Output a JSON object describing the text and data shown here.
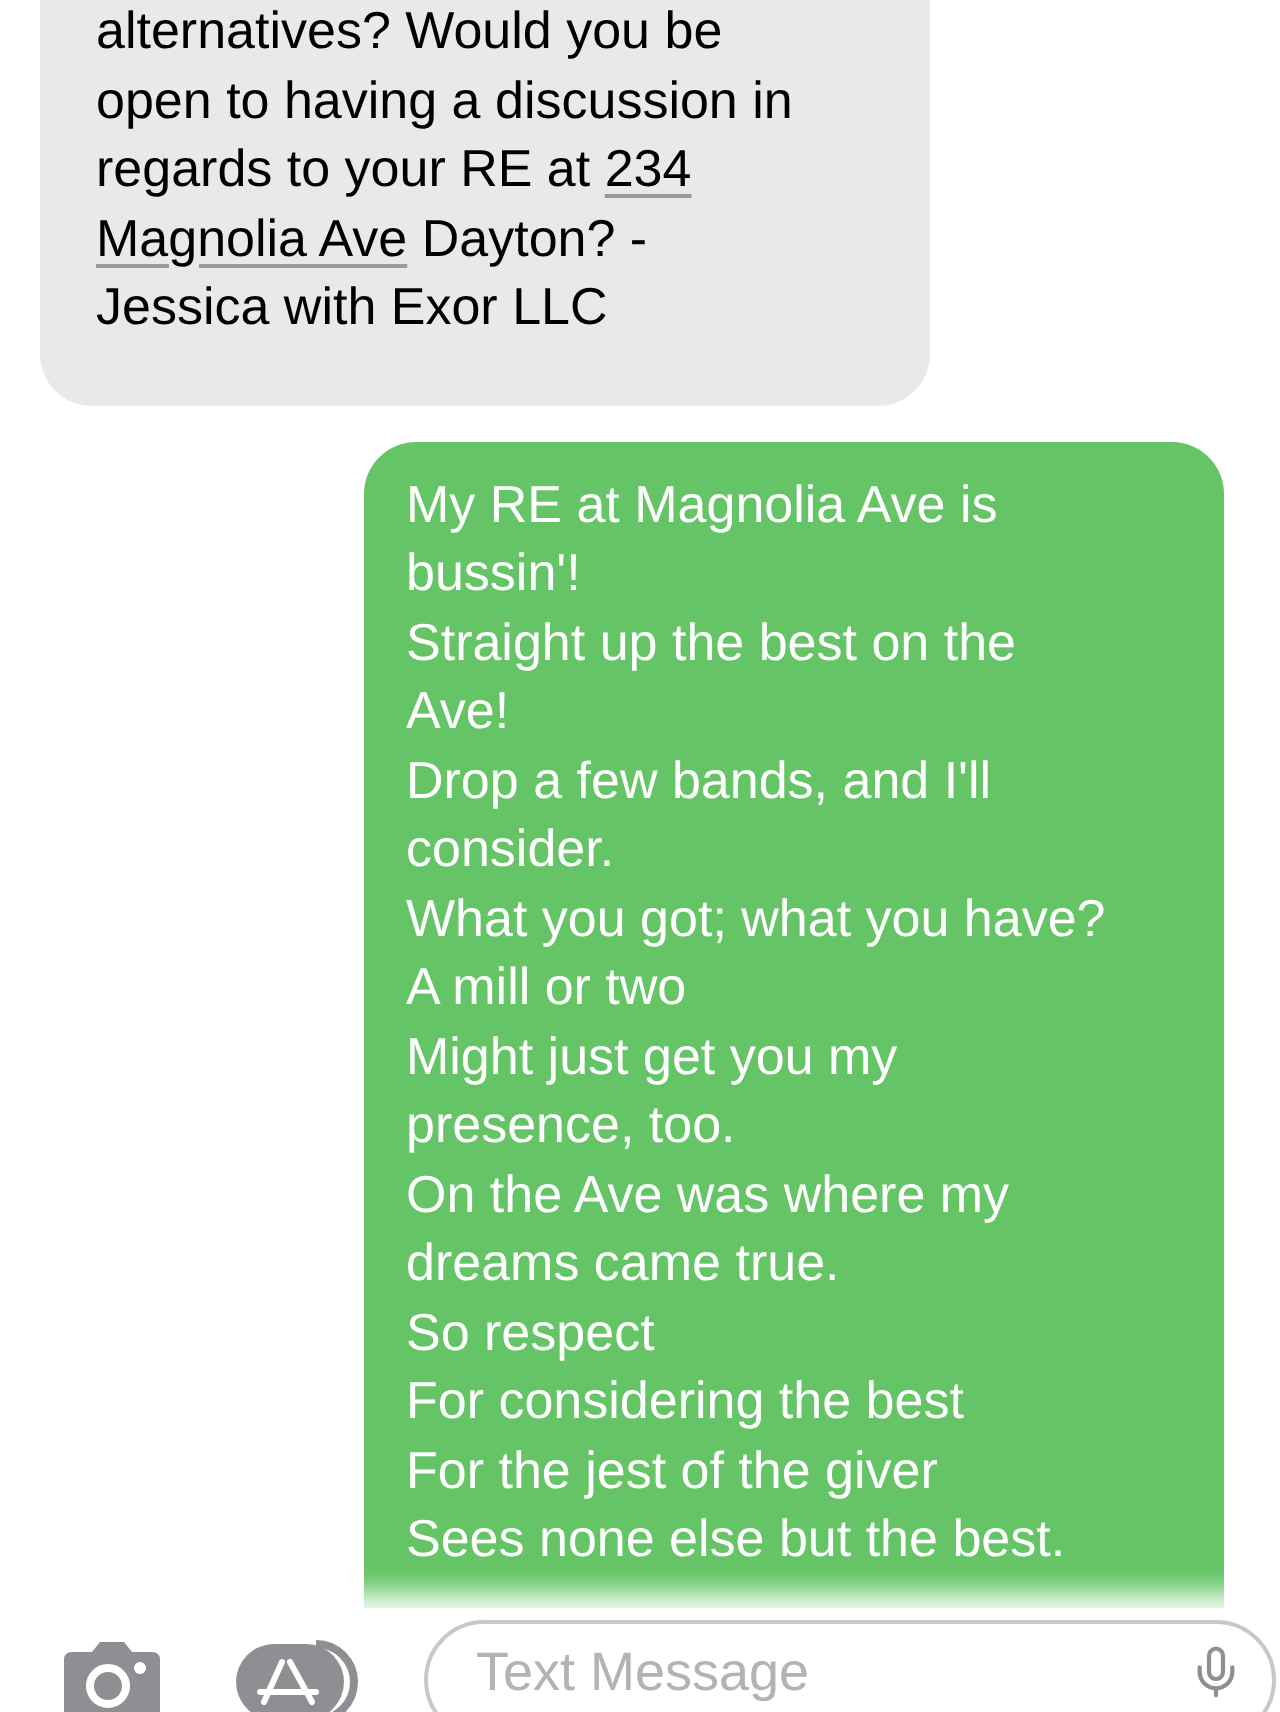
{
  "incoming": {
    "lines": [
      [
        {
          "kind": "text",
          "text": "alternatives? Would you be"
        }
      ],
      [
        {
          "kind": "text",
          "text": "open to having a discussion in"
        }
      ],
      [
        {
          "kind": "text",
          "text": "regards to your RE at "
        },
        {
          "kind": "link",
          "text": "234"
        }
      ],
      [
        {
          "kind": "link",
          "text": "Magnolia Ave"
        },
        {
          "kind": "text",
          "text": " Dayton? -"
        }
      ],
      [
        {
          "kind": "text",
          "text": "Jessica with Exor LLC"
        }
      ]
    ]
  },
  "outgoing": {
    "lines": [
      "My RE at Magnolia Ave is",
      "bussin'!",
      "Straight up the best on the",
      "Ave!",
      "Drop a few bands, and I'll",
      "consider.",
      "What you got; what you have?",
      "A mill or two",
      "Might just get you my",
      "presence, too.",
      "On the Ave was where my",
      "dreams came true.",
      "So respect",
      "For considering the best",
      "For the jest of the giver",
      "Sees none else but the best."
    ]
  },
  "composer": {
    "placeholder": "Text Message"
  }
}
